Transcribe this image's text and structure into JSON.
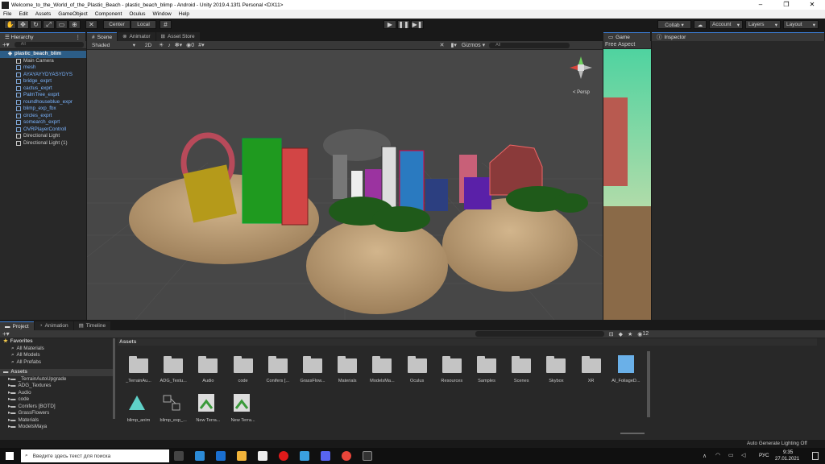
{
  "window": {
    "title": "Welcome_to_the_World_of_the_Plastic_Beach - plastic_beach_blimp - Android - Unity 2019.4.13f1 Personal <DX11>",
    "controls": [
      "–",
      "❐",
      "✕"
    ]
  },
  "menu": [
    "File",
    "Edit",
    "Assets",
    "GameObject",
    "Component",
    "Oculus",
    "Window",
    "Help"
  ],
  "toolbar": {
    "pivot": "Center",
    "space": "Local",
    "right_buttons": [
      "Collab ▾",
      "Account",
      "Layers",
      "Layout"
    ]
  },
  "hierarchy": {
    "tab": "Hierarchy",
    "search_placeholder": "All",
    "scene_name": "plastic_beach_blim",
    "items": [
      {
        "label": "Main Camera",
        "blue": false
      },
      {
        "label": "mesh",
        "blue": true
      },
      {
        "label": "AYAYAYYDYASYDYS",
        "blue": true
      },
      {
        "label": "bridge_exprt",
        "blue": true
      },
      {
        "label": "cactus_exprt",
        "blue": true
      },
      {
        "label": "PalmTree_exprt",
        "blue": true
      },
      {
        "label": "roundhouseblue_expr",
        "blue": true
      },
      {
        "label": "blimp_exp_fbx",
        "blue": true
      },
      {
        "label": "circles_exprt",
        "blue": true
      },
      {
        "label": "somearch_exprt",
        "blue": true
      },
      {
        "label": "OVRPlayerControll",
        "blue": true
      },
      {
        "label": "Directional Light",
        "blue": false
      },
      {
        "label": "Directional Light (1)",
        "blue": false
      }
    ]
  },
  "scene_tabs": [
    "Scene",
    "Animator",
    "Asset Store"
  ],
  "scene_bar": {
    "shading": "Shaded",
    "mode2d": "2D",
    "gizmos": "Gizmos",
    "search_placeholder": "All",
    "hidden_count": "0",
    "persp": "< Persp"
  },
  "game": {
    "tab": "Game",
    "aspect": "Free Aspect"
  },
  "inspector": {
    "tab": "Inspector"
  },
  "project_tabs": [
    "Project",
    "Animation",
    "Timeline"
  ],
  "project_tree": {
    "favorites": "Favorites",
    "favorite_items": [
      "All Materials",
      "All Models",
      "All Prefabs"
    ],
    "assets": "Assets",
    "asset_items": [
      "_TerrainAutoUpgrade",
      "ADG_Textures",
      "Audio",
      "code",
      "Conifers [BOTD]",
      "GrassFlowers",
      "Materials",
      "ModelsMaya"
    ]
  },
  "assets_header": "Assets",
  "hidden_items_count": "12",
  "assets_row1": [
    "_TerrainAu...",
    "ADG_Textu...",
    "Audio",
    "code",
    "Conifers [...",
    "GrassFlow...",
    "Materials",
    "ModelsMa...",
    "Oculus",
    "Resources",
    "Samples",
    "Scenes",
    "Skybox",
    "XR",
    "AI_FoliageD..."
  ],
  "assets_row2": [
    "blimp_anim",
    "blimp_exp_...",
    "New Terra...",
    "New Terra..."
  ],
  "status": "Auto Generate Lighting Off",
  "taskbar": {
    "search_placeholder": "Введите здесь текст для поиска",
    "lang": "РУС",
    "time": "9:35",
    "date": "27.01.2021"
  },
  "colors": {
    "accent": "#3c7fd8",
    "panel": "#282828",
    "scene_bg": "#474747",
    "sand": "#bfa27a"
  }
}
